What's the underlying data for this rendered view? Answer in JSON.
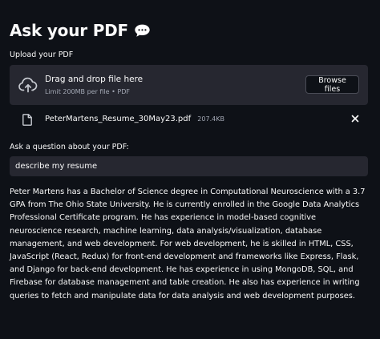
{
  "header": {
    "title": "Ask your PDF",
    "icon": "speech-bubble-icon"
  },
  "uploader": {
    "label": "Upload your PDF",
    "drop_text": "Drag and drop file here",
    "limit_text": "Limit 200MB per file • PDF",
    "browse_label": "Browse files",
    "cloud_icon": "upload-cloud-icon"
  },
  "uploaded_file": {
    "name": "PeterMartens_Resume_30May23.pdf",
    "size": "207.4KB",
    "file_icon": "file-icon",
    "remove_icon": "close-icon"
  },
  "question": {
    "label": "Ask a question about your PDF:",
    "value": "describe my resume"
  },
  "answer": {
    "text": "Peter Martens has a Bachelor of Science degree in Computational Neuroscience with a 3.7 GPA from The Ohio State University. He is currently enrolled in the Google Data Analytics Professional Certificate program. He has experience in model-based cognitive neuroscience research, machine learning, data analysis/visualization, database management, and web development. For web development, he is skilled in HTML, CSS, JavaScript (React, Redux) for front-end development and frameworks like Express, Flask, and Django for back-end development. He has experience in using MongoDB, SQL, and Firebase for database management and table creation. He also has experience in writing queries to fetch and manipulate data for data analysis and web development purposes."
  },
  "colors": {
    "background": "#0e1117",
    "widget_background": "#262730",
    "text": "#fafafa",
    "muted_text": "#a3a8b4"
  }
}
